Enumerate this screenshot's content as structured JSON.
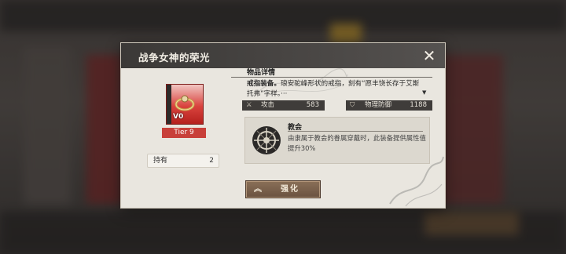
{
  "dialog": {
    "title": "战争女神的荣光",
    "close_icon": "close-icon"
  },
  "item": {
    "icon": "ring-icon",
    "level_text": "V0",
    "tier_label": "Tier 9",
    "owned_label": "持有",
    "owned_count": "2",
    "card_color": "#d9433e"
  },
  "details": {
    "section_label": "物品详情",
    "desc_bold": "戒指装备。",
    "desc_rest": "琅安驼峰形状的戒指，刻有“愿丰饶长存于艾斯托弗”字样。···",
    "scroll_icon": "triangle-down-icon",
    "stats": [
      {
        "icon": "sword-icon",
        "name": "攻击",
        "value": "583"
      },
      {
        "icon": "shield-icon",
        "name": "物理防御",
        "value": "1188"
      }
    ]
  },
  "set_bonus": {
    "icon": "church-emblem-icon",
    "title": "教会",
    "description": "由隶属于教会的眷属穿戴时，此装备提供属性值提升30%"
  },
  "actions": {
    "enhance_icon": "double-chevron-up-icon",
    "enhance_label": "强化",
    "accent": "#6a5240"
  }
}
